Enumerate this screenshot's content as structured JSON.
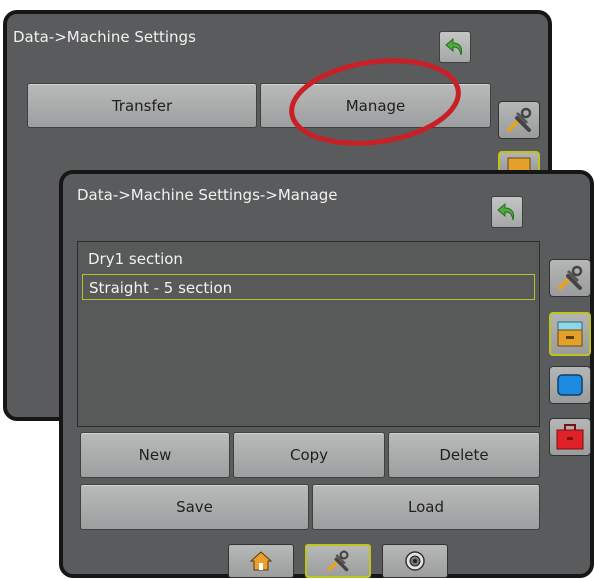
{
  "back_screen": {
    "title": "Data->Machine Settings",
    "buttons": {
      "transfer": "Transfer",
      "manage": "Manage"
    }
  },
  "front_screen": {
    "title": "Data->Machine Settings->Manage",
    "list": [
      {
        "label": "Dry1 section",
        "selected": false
      },
      {
        "label": "Straight - 5 section",
        "selected": true
      }
    ],
    "buttons": {
      "new": "New",
      "copy": "Copy",
      "delete": "Delete",
      "save": "Save",
      "load": "Load"
    },
    "side_tabs": [
      "tools-icon",
      "drawer-icon",
      "display-icon",
      "toolbox-icon"
    ],
    "bottom_tabs": [
      "home-icon",
      "tools-icon",
      "gps-target-icon"
    ]
  },
  "colors": {
    "screen_bg": "#5a5b5c",
    "bezel": "#161616",
    "highlight": "#c91f26",
    "selected_outline": "#b6c22b",
    "return_arrow": "#4daa3b"
  }
}
